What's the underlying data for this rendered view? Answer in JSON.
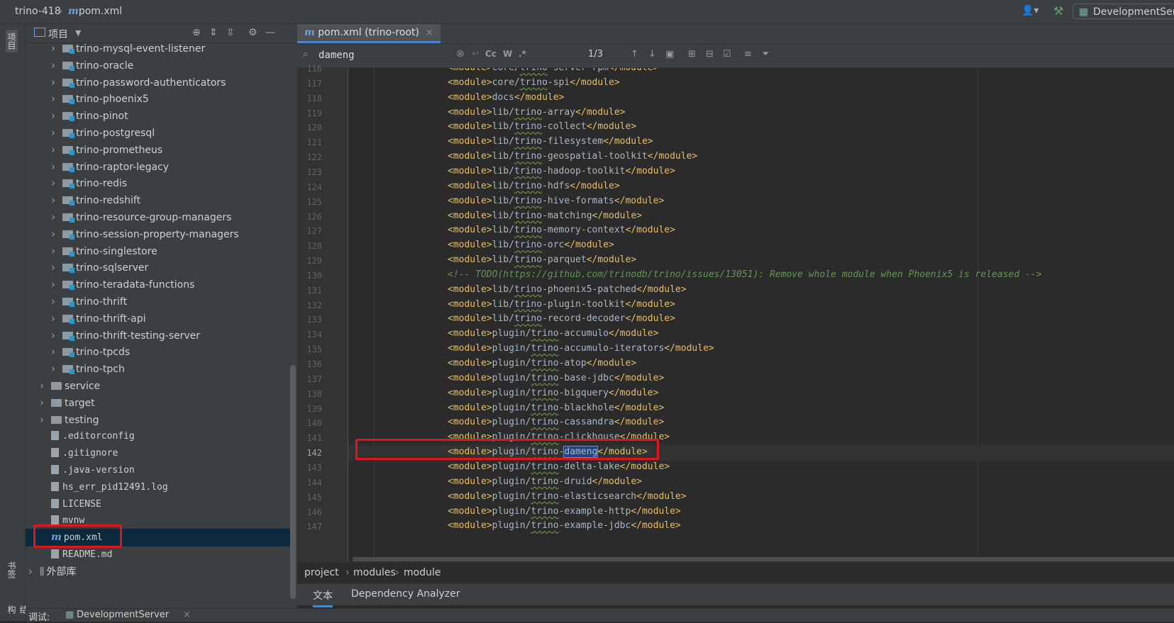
{
  "titlebar": {
    "project": "trino-418",
    "file": "pom.xml",
    "run_config": "DevelopmentServer"
  },
  "left_stripe": {
    "project_tab": "项目",
    "bookmarks_tab": "书签",
    "structure_tab": "结构"
  },
  "project_panel": {
    "title": "项目",
    "tree": [
      {
        "label": "trino-mysql-event-listener",
        "kind": "module",
        "level": 2
      },
      {
        "label": "trino-oracle",
        "kind": "module",
        "level": 2
      },
      {
        "label": "trino-password-authenticators",
        "kind": "module",
        "level": 2
      },
      {
        "label": "trino-phoenix5",
        "kind": "module",
        "level": 2
      },
      {
        "label": "trino-pinot",
        "kind": "module",
        "level": 2
      },
      {
        "label": "trino-postgresql",
        "kind": "module",
        "level": 2
      },
      {
        "label": "trino-prometheus",
        "kind": "module",
        "level": 2
      },
      {
        "label": "trino-raptor-legacy",
        "kind": "module",
        "level": 2
      },
      {
        "label": "trino-redis",
        "kind": "module",
        "level": 2
      },
      {
        "label": "trino-redshift",
        "kind": "module",
        "level": 2
      },
      {
        "label": "trino-resource-group-managers",
        "kind": "module",
        "level": 2
      },
      {
        "label": "trino-session-property-managers",
        "kind": "module",
        "level": 2
      },
      {
        "label": "trino-singlestore",
        "kind": "module",
        "level": 2
      },
      {
        "label": "trino-sqlserver",
        "kind": "module",
        "level": 2
      },
      {
        "label": "trino-teradata-functions",
        "kind": "module",
        "level": 2
      },
      {
        "label": "trino-thrift",
        "kind": "module",
        "level": 2
      },
      {
        "label": "trino-thrift-api",
        "kind": "module",
        "level": 2
      },
      {
        "label": "trino-thrift-testing-server",
        "kind": "module",
        "level": 2
      },
      {
        "label": "trino-tpcds",
        "kind": "module",
        "level": 2
      },
      {
        "label": "trino-tpch",
        "kind": "module",
        "level": 2
      },
      {
        "label": "service",
        "kind": "folder",
        "level": 1
      },
      {
        "label": "target",
        "kind": "folder",
        "level": 1
      },
      {
        "label": "testing",
        "kind": "folder",
        "level": 1
      },
      {
        "label": ".editorconfig",
        "kind": "file",
        "level": 1
      },
      {
        "label": ".gitignore",
        "kind": "file",
        "level": 1
      },
      {
        "label": ".java-version",
        "kind": "file",
        "level": 1
      },
      {
        "label": "hs_err_pid12491.log",
        "kind": "file",
        "level": 1
      },
      {
        "label": "LICENSE",
        "kind": "file",
        "level": 1
      },
      {
        "label": "mvnw",
        "kind": "file",
        "level": 1
      },
      {
        "label": "pom.xml",
        "kind": "maven",
        "level": 1,
        "selected": true
      },
      {
        "label": "README.md",
        "kind": "file",
        "level": 1
      },
      {
        "label": "外部库",
        "kind": "library",
        "level": 0
      }
    ]
  },
  "editor": {
    "tab_label": "pom.xml (trino-root)",
    "search": {
      "query": "dameng",
      "match_count": "1/3",
      "case_label": "Cc",
      "word_label": "W",
      "regex_label": ".*"
    },
    "lines": [
      {
        "n": "116",
        "t": "<module>core/trino-server-rpm</module>"
      },
      {
        "n": "117",
        "t": "<module>core/trino-spi</module>"
      },
      {
        "n": "118",
        "t": "<module>docs</module>"
      },
      {
        "n": "119",
        "t": "<module>lib/trino-array</module>"
      },
      {
        "n": "120",
        "t": "<module>lib/trino-collect</module>"
      },
      {
        "n": "121",
        "t": "<module>lib/trino-filesystem</module>"
      },
      {
        "n": "122",
        "t": "<module>lib/trino-geospatial-toolkit</module>"
      },
      {
        "n": "123",
        "t": "<module>lib/trino-hadoop-toolkit</module>"
      },
      {
        "n": "124",
        "t": "<module>lib/trino-hdfs</module>"
      },
      {
        "n": "125",
        "t": "<module>lib/trino-hive-formats</module>"
      },
      {
        "n": "126",
        "t": "<module>lib/trino-matching</module>"
      },
      {
        "n": "127",
        "t": "<module>lib/trino-memory-context</module>"
      },
      {
        "n": "128",
        "t": "<module>lib/trino-orc</module>"
      },
      {
        "n": "129",
        "t": "<module>lib/trino-parquet</module>"
      },
      {
        "n": "130",
        "t": "<!-- TODO(https://github.com/trinodb/trino/issues/13051): Remove whole module when Phoenix5 is released -->",
        "comment": true
      },
      {
        "n": "131",
        "t": "<module>lib/trino-phoenix5-patched</module>"
      },
      {
        "n": "132",
        "t": "<module>lib/trino-plugin-toolkit</module>"
      },
      {
        "n": "133",
        "t": "<module>lib/trino-record-decoder</module>"
      },
      {
        "n": "134",
        "t": "<module>plugin/trino-accumulo</module>"
      },
      {
        "n": "135",
        "t": "<module>plugin/trino-accumulo-iterators</module>"
      },
      {
        "n": "136",
        "t": "<module>plugin/trino-atop</module>"
      },
      {
        "n": "137",
        "t": "<module>plugin/trino-base-jdbc</module>"
      },
      {
        "n": "138",
        "t": "<module>plugin/trino-bigquery</module>"
      },
      {
        "n": "139",
        "t": "<module>plugin/trino-blackhole</module>"
      },
      {
        "n": "140",
        "t": "<module>plugin/trino-cassandra</module>"
      },
      {
        "n": "141",
        "t": "<module>plugin/trino-clickhouse</module>"
      },
      {
        "n": "142",
        "t": "<module>plugin/trino-dameng</module>",
        "current": true
      },
      {
        "n": "143",
        "t": "<module>plugin/trino-delta-lake</module>"
      },
      {
        "n": "144",
        "t": "<module>plugin/trino-druid</module>"
      },
      {
        "n": "145",
        "t": "<module>plugin/trino-elasticsearch</module>"
      },
      {
        "n": "146",
        "t": "<module>plugin/trino-example-http</module>"
      },
      {
        "n": "147",
        "t": "<module>plugin/trino-example-jdbc</module>"
      }
    ],
    "breadcrumb": [
      "project",
      "modules",
      "module"
    ],
    "bottom_tabs": [
      "文本",
      "Dependency Analyzer"
    ]
  },
  "statusbar": {
    "debug_label": "调试:",
    "debug_config": "DevelopmentServer"
  },
  "colors": {
    "accent": "#4a88c7",
    "highlight_box": "#e0161c",
    "xml_tag": "#e8bf6a",
    "comment": "#629755"
  }
}
